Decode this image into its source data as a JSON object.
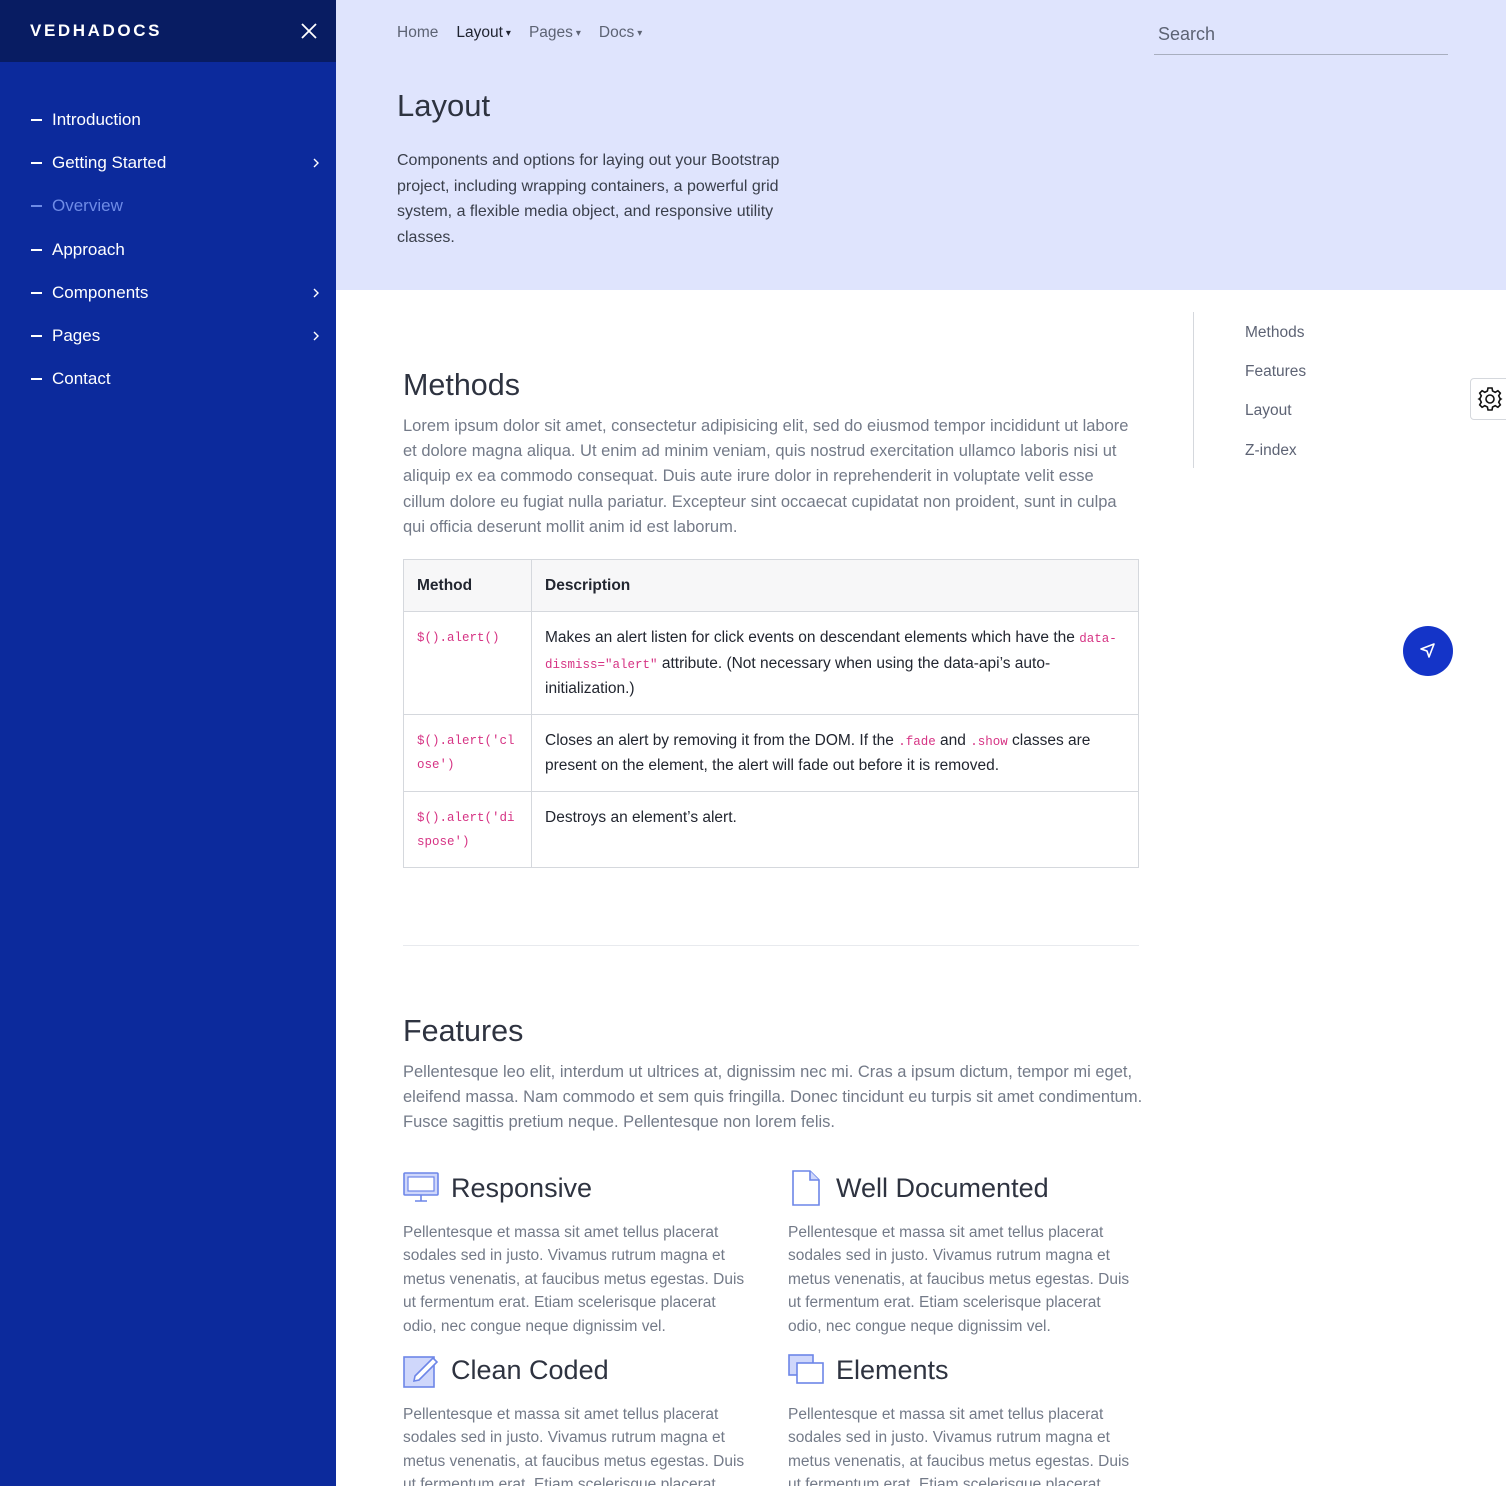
{
  "sidebar": {
    "brand": "VEDHADOCS",
    "items": [
      {
        "label": "Introduction"
      },
      {
        "label": "Getting Started"
      },
      {
        "label": "Overview"
      },
      {
        "label": "Approach"
      },
      {
        "label": "Components"
      },
      {
        "label": "Pages"
      },
      {
        "label": "Contact"
      }
    ]
  },
  "topnav": {
    "items": [
      {
        "label": "Home"
      },
      {
        "label": "Layout"
      },
      {
        "label": "Pages"
      },
      {
        "label": "Docs"
      }
    ],
    "search_placeholder": "Search"
  },
  "header": {
    "title": "Layout",
    "lead": "Components and options for laying out your Bootstrap project, including wrapping containers, a powerful grid system, a flexible media object, and responsive utility classes."
  },
  "methods": {
    "title": "Methods",
    "text": "Lorem ipsum dolor sit amet, consectetur adipisicing elit, sed do eiusmod tempor incididunt ut labore et dolore magna aliqua. Ut enim ad minim veniam, quis nostrud exercitation ullamco laboris nisi ut aliquip ex ea commodo consequat. Duis aute irure dolor in reprehenderit in voluptate velit esse cillum dolore eu fugiat nulla pariatur. Excepteur sint occaecat cupidatat non proident, sunt in culpa qui officia deserunt mollit anim id est laborum.",
    "table": {
      "headers": [
        "Method",
        "Description"
      ],
      "rows": [
        {
          "method": "$().alert()",
          "desc_a": "Makes an alert listen for click events on descendant elements which have the ",
          "code_a": "data-dismiss=\"alert\"",
          "desc_b": " attribute. (Not necessary when using the data-api’s auto-initialization.)"
        },
        {
          "method": "$().alert('close')",
          "desc_a": "Closes an alert by removing it from the DOM. If the ",
          "code_a": ".fade",
          "desc_b": " and ",
          "code_b": ".show",
          "desc_c": " classes are present on the element, the alert will fade out before it is removed."
        },
        {
          "method": "$().alert('dispose')",
          "desc_a": "Destroys an element’s alert."
        }
      ]
    }
  },
  "features": {
    "title": "Features",
    "text": "Pellentesque leo elit, interdum ut ultrices at, dignissim nec mi. Cras a ipsum dictum, tempor mi eget, eleifend massa. Nam commodo et sem quis fringilla. Donec tincidunt eu turpis sit amet condimentum. Fusce sagittis pretium neque. Pellentesque non lorem felis.",
    "items": [
      {
        "title": "Responsive",
        "icon": "monitor-icon",
        "body": "Pellentesque et massa sit amet tellus placerat sodales sed in justo. Vivamus rutrum magna et metus venenatis, at faucibus metus egestas. Duis ut fermentum erat. Etiam scelerisque placerat odio, nec congue neque dignissim vel."
      },
      {
        "title": "Well Documented",
        "icon": "document-icon",
        "body": "Pellentesque et massa sit amet tellus placerat sodales sed in justo. Vivamus rutrum magna et metus venenatis, at faucibus metus egestas. Duis ut fermentum erat. Etiam scelerisque placerat odio, nec congue neque dignissim vel."
      },
      {
        "title": "Clean Coded",
        "icon": "edit-icon",
        "body": "Pellentesque et massa sit amet tellus placerat sodales sed in justo. Vivamus rutrum magna et metus venenatis, at faucibus metus egestas. Duis ut fermentum erat. Etiam scelerisque placerat odio, nec congue neque dignissim vel."
      },
      {
        "title": "Elements",
        "icon": "layers-icon",
        "body": "Pellentesque et massa sit amet tellus placerat sodales sed in justo. Vivamus rutrum magna et metus venenatis, at faucibus metus egestas. Duis ut fermentum erat. Etiam scelerisque placerat odio, nec congue neque dignissim vel."
      }
    ]
  },
  "toc": {
    "items": [
      {
        "label": "Methods"
      },
      {
        "label": "Features"
      },
      {
        "label": "Layout"
      },
      {
        "label": "Z-index"
      }
    ]
  },
  "colors": {
    "sidebar_bg": "#0c2a9c",
    "sidebar_head_bg": "#081c62",
    "header_bg": "#dfe4fd",
    "accent": "#1434c8",
    "code": "#d63384"
  }
}
